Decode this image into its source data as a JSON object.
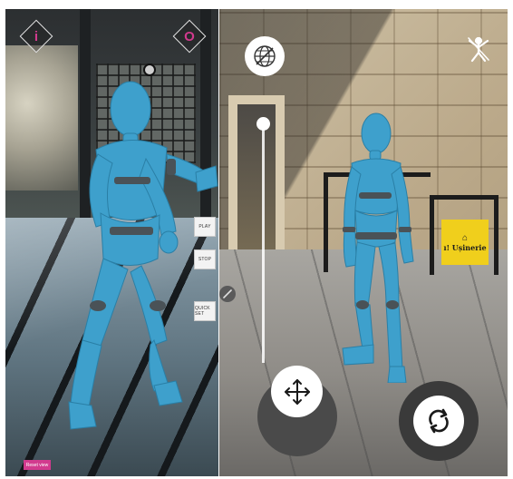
{
  "left_view": {
    "info_label": "i",
    "record_label": "O",
    "play_label": "PLAY",
    "stop_label": "STOP",
    "quick_set_label": "QUICK SET",
    "reset_label": "Reset view"
  },
  "right_view": {
    "sign_glyph": "⌂",
    "sign_text": "ı! Ușinerie"
  },
  "icons": {
    "info": "info-icon",
    "record": "record-icon",
    "globe": "globe-icon",
    "pose": "pose-icon",
    "move": "move-icon",
    "rotate": "rotate-icon",
    "edit": "edit-icon"
  },
  "colors": {
    "accent": "#d23a8e",
    "mannequin": "#3ea0cc",
    "mannequin_joint": "#4a5257",
    "sign": "#f0cf1c"
  }
}
